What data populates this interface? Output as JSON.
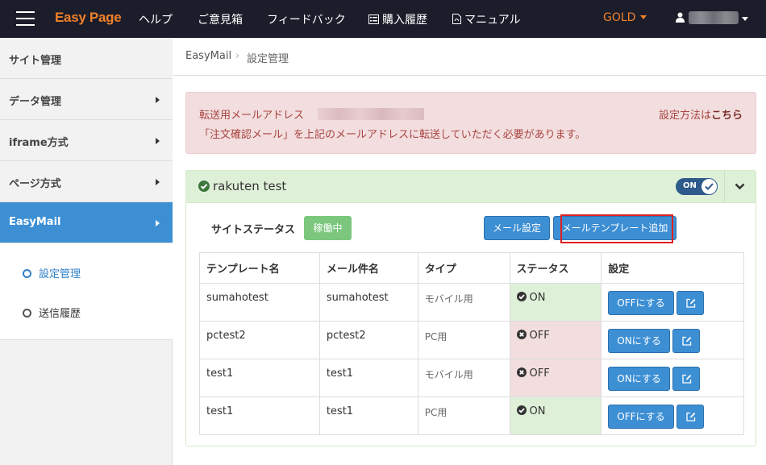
{
  "topbar": {
    "brand": "Easy Page",
    "nav": [
      {
        "label": "ヘルプ",
        "icon": ""
      },
      {
        "label": "ご意見箱",
        "icon": ""
      },
      {
        "label": "フィードバック",
        "icon": ""
      },
      {
        "label": "購入履歴",
        "icon": "list-icon"
      },
      {
        "label": "マニュアル",
        "icon": "pdf-icon"
      }
    ],
    "plan": "GOLD",
    "user_icon": "user-icon"
  },
  "sidebar": {
    "items": [
      {
        "label": "サイト管理"
      },
      {
        "label": "データ管理"
      },
      {
        "label": "iframe方式"
      },
      {
        "label": "ページ方式"
      },
      {
        "label": "EasyMail"
      }
    ],
    "sub_items": [
      {
        "label": "設定管理"
      },
      {
        "label": "送信履歴"
      }
    ]
  },
  "breadcrumb": {
    "root": "EasyMail",
    "current": "設定管理"
  },
  "alert": {
    "line1": "転送用メールアドレス",
    "line2": "「注文確認メール」を上記のメールアドレスに転送していただく必要があります。",
    "howto_prefix": "設定方法は",
    "howto_link": "こちら"
  },
  "panel": {
    "title": "rakuten test",
    "toggle_label": "ON",
    "site_status_label": "サイトステータス",
    "status_badge": "稼働中",
    "mail_setting_button": "メール設定",
    "template_add_button": "メールテンプレート追加",
    "table": {
      "headers": [
        "テンプレート名",
        "メール件名",
        "タイプ",
        "ステータス",
        "設定"
      ],
      "rows": [
        {
          "name": "sumahotest",
          "subject": "sumahotest",
          "type": "モバイル用",
          "status": "ON",
          "action": "OFFにする"
        },
        {
          "name": "pctest2",
          "subject": "pctest2",
          "type": "PC用",
          "status": "OFF",
          "action": "ONにする"
        },
        {
          "name": "test1",
          "subject": "test1",
          "type": "モバイル用",
          "status": "OFF",
          "action": "ONにする"
        },
        {
          "name": "test1",
          "subject": "test1",
          "type": "PC用",
          "status": "ON",
          "action": "OFFにする"
        }
      ]
    }
  },
  "colors": {
    "topbar_bg": "#1b1d2a",
    "brand": "#f0812a",
    "accent_blue": "#3d8fd4",
    "alert_bg": "#f2dede",
    "panel_head_bg": "#dff0d8",
    "highlight": "#e02020"
  }
}
